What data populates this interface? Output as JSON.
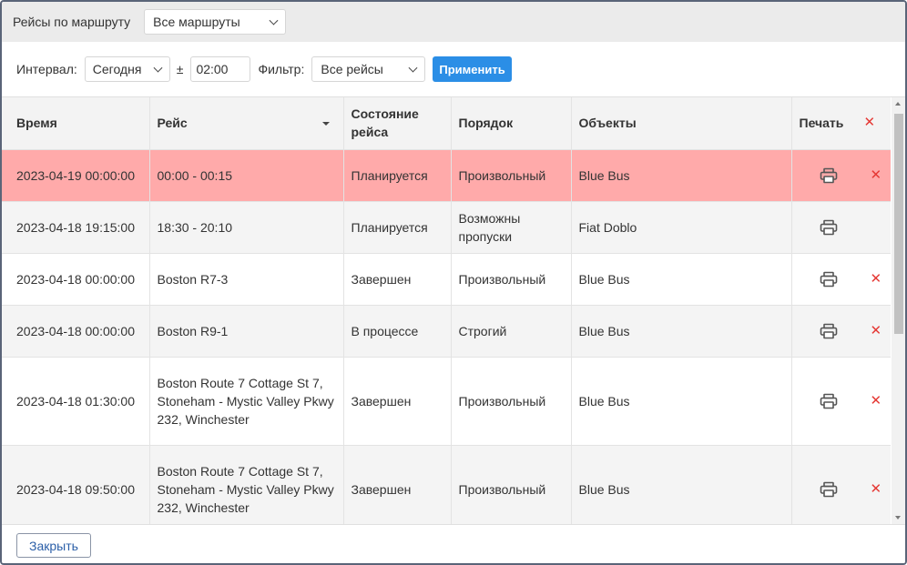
{
  "topbar": {
    "route_label": "Рейсы по маршруту",
    "route_select": "Все маршруты"
  },
  "filters": {
    "interval_label": "Интервал:",
    "interval_select": "Сегодня",
    "plus_minus": "±",
    "time_value": "02:00",
    "filter_label": "Фильтр:",
    "filter_select": "Все рейсы",
    "apply_label": "Применить"
  },
  "table": {
    "headers": {
      "time": "Время",
      "trip": "Рейс",
      "state": "Состояние рейса",
      "order": "Порядок",
      "objects": "Объекты",
      "print": "Печать"
    },
    "rows": [
      {
        "time": "2023-04-19 00:00:00",
        "trip": "00:00 - 00:15",
        "state": "Планируется",
        "order": "Произвольный",
        "objects": "Blue Bus",
        "deletable": true,
        "highlight": true
      },
      {
        "time": "2023-04-18 19:15:00",
        "trip": "18:30 - 20:10",
        "state": "Планируется",
        "order": "Возможны пропуски",
        "objects": "Fiat Doblo",
        "deletable": false,
        "highlight": false
      },
      {
        "time": "2023-04-18 00:00:00",
        "trip": "Boston R7-3",
        "state": "Завершен",
        "order": "Произвольный",
        "objects": "Blue Bus",
        "deletable": true,
        "highlight": false
      },
      {
        "time": "2023-04-18 00:00:00",
        "trip": "Boston R9-1",
        "state": "В процессе",
        "order": "Строгий",
        "objects": "Blue Bus",
        "deletable": true,
        "highlight": false
      },
      {
        "time": "2023-04-18 01:30:00",
        "trip": "Boston Route 7 Cottage St 7, Stoneham - Mystic Valley Pkwy 232, Winchester",
        "state": "Завершен",
        "order": "Произвольный",
        "objects": "Blue Bus",
        "deletable": true,
        "highlight": false
      },
      {
        "time": "2023-04-18 09:50:00",
        "trip": "Boston Route 7 Cottage St 7, Stoneham - Mystic Valley Pkwy 232, Winchester",
        "state": "Завершен",
        "order": "Произвольный",
        "objects": "Blue Bus",
        "deletable": true,
        "highlight": false
      }
    ]
  },
  "footer": {
    "close_label": "Закрыть"
  },
  "colors": {
    "accent": "#2b8ee6",
    "highlight_row": "#ffaaaa",
    "delete": "#e53935"
  },
  "icons": {
    "print": "printer-icon",
    "delete": "close-icon"
  }
}
